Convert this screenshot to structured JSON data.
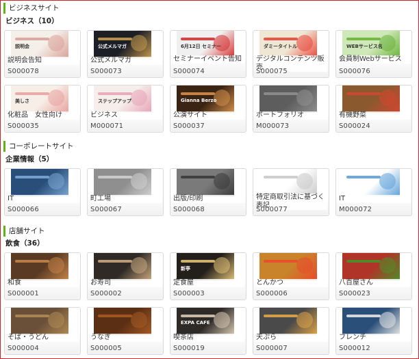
{
  "sections": [
    {
      "title": "ビジネスサイト",
      "subtitle": "ビジネス（10）",
      "cards": [
        {
          "name": "説明会告知",
          "code": "S000078",
          "bg": "#f4efe8",
          "accent": "#d9a29a",
          "label": "説明会"
        },
        {
          "name": "公式メルマガ",
          "code": "S000073",
          "bg": "#1d1f27",
          "accent": "#c69b4e",
          "label": "公式メルマガ"
        },
        {
          "name": "セミナーイベント告知",
          "code": "S000074",
          "bg": "#f0f0f0",
          "accent": "#d62f2f",
          "label": "6月12日 セミナー"
        },
        {
          "name": "デジタルコンテンツ販売",
          "code": "S000075",
          "bg": "#efe7d4",
          "accent": "#e9473a",
          "label": "ダミータイトル"
        },
        {
          "name": "会員制Webサービス",
          "code": "S000076",
          "bg": "#cfe8b8",
          "accent": "#6ab23a",
          "label": "WEBサービス名"
        },
        {
          "name": "化粧品　女性向け",
          "code": "S000035",
          "bg": "#f7efe7",
          "accent": "#e8a3a0",
          "label": "美しさ"
        },
        {
          "name": "ビジネス",
          "code": "M000071",
          "bg": "#f5eeea",
          "accent": "#e8a3b8",
          "label": "ステップアップ"
        },
        {
          "name": "公演サイト",
          "code": "S000037",
          "bg": "#3b2414",
          "accent": "#d58f4b",
          "label": "Gianna Berzo"
        },
        {
          "name": "ポートフォリオ",
          "code": "M000073",
          "bg": "#5d5d5d",
          "accent": "#8f8f8f",
          "label": ""
        },
        {
          "name": "有機野菜",
          "code": "S000024",
          "bg": "#8a5a2e",
          "accent": "#d64530",
          "label": ""
        }
      ]
    },
    {
      "title": "コーポレートサイト",
      "subtitle": "企業情報（5）",
      "cards": [
        {
          "name": "IT",
          "code": "S000066",
          "bg": "#2a4e7a",
          "accent": "#7ba6d3",
          "label": ""
        },
        {
          "name": "町工場",
          "code": "S000067",
          "bg": "#8f8f8f",
          "accent": "#cfcfcf",
          "label": ""
        },
        {
          "name": "出版/印刷",
          "code": "S000068",
          "bg": "#7a7a7a",
          "accent": "#3a3a3a",
          "label": ""
        },
        {
          "name": "特定商取引法に基づく表記",
          "code": "S000077",
          "bg": "#ffffff",
          "accent": "#c9c9c9",
          "label": ""
        },
        {
          "name": "IT",
          "code": "M000072",
          "bg": "#ffffff",
          "accent": "#5fa0d8",
          "label": ""
        }
      ]
    },
    {
      "title": "店舗サイト",
      "subtitle": "飲食（36）",
      "cards": [
        {
          "name": "和食",
          "code": "S000001",
          "bg": "#5a3a22",
          "accent": "#c48449",
          "label": ""
        },
        {
          "name": "お寿司",
          "code": "S000002",
          "bg": "#2f2a26",
          "accent": "#c8a77f",
          "label": ""
        },
        {
          "name": "定食屋",
          "code": "S000003",
          "bg": "#231f1a",
          "accent": "#e0c078",
          "label": "新亭"
        },
        {
          "name": "とんかつ",
          "code": "S000006",
          "bg": "#c8832b",
          "accent": "#e94a2b",
          "label": ""
        },
        {
          "name": "八百屋さん",
          "code": "S000023",
          "bg": "#b03428",
          "accent": "#4d8f2a",
          "label": ""
        },
        {
          "name": "そば・うどん",
          "code": "S000004",
          "bg": "#6a5038",
          "accent": "#b08a55",
          "label": ""
        },
        {
          "name": "うなぎ",
          "code": "S000005",
          "bg": "#5b2f14",
          "accent": "#a65a24",
          "label": ""
        },
        {
          "name": "喫茶店",
          "code": "S000019",
          "bg": "#2d2a28",
          "accent": "#d8c9b2",
          "label": "EXPA CAFE"
        },
        {
          "name": "天ぷら",
          "code": "S000007",
          "bg": "#4a4a4a",
          "accent": "#e0a447",
          "label": ""
        },
        {
          "name": "フレンチ",
          "code": "S000012",
          "bg": "#2a4f78",
          "accent": "#e6e6e6",
          "label": ""
        }
      ]
    }
  ]
}
